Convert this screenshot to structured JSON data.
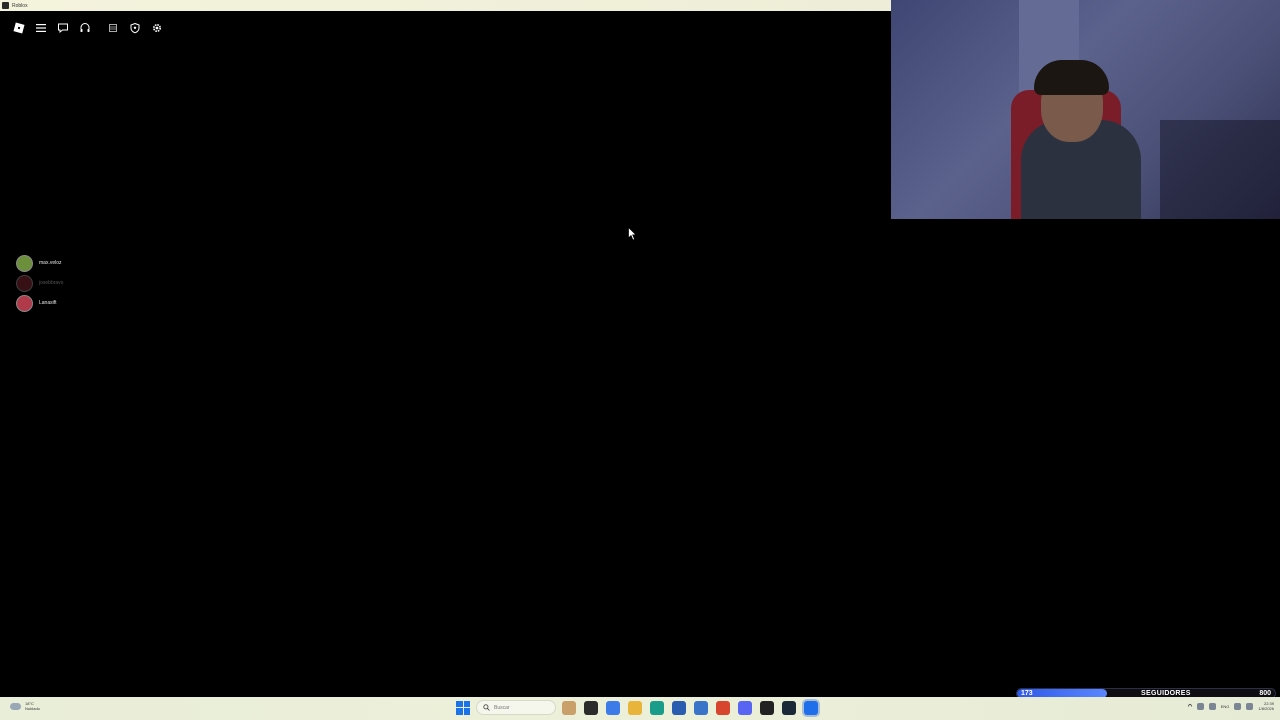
{
  "window": {
    "title": "Roblox"
  },
  "topbar": {
    "icons": [
      "roblox-logo-icon",
      "menu-icon",
      "chat-icon",
      "headset-icon",
      "inventory-icon",
      "shield-icon",
      "gear-icon"
    ]
  },
  "players": [
    {
      "name": "max.veloz",
      "avatar_color": "#6b8f3a",
      "dim": false
    },
    {
      "name": "josebbravo",
      "avatar_color": "#7a2530",
      "dim": true
    },
    {
      "name": "Lanasift",
      "avatar_color": "#b03a4a",
      "dim": false
    }
  ],
  "taskbar": {
    "weather_temp": "18°C",
    "weather_desc": "Nublado",
    "search_placeholder": "Buscar",
    "apps": [
      {
        "name": "assistant-app",
        "color": "#c9a06a"
      },
      {
        "name": "file-explorer-app",
        "color": "#2b2b2b"
      },
      {
        "name": "copilot-app",
        "color": "#3c7be8"
      },
      {
        "name": "folder-app",
        "color": "#e8b43a"
      },
      {
        "name": "edge-app",
        "color": "#1a9c8a"
      },
      {
        "name": "store-app",
        "color": "#2a5db0"
      },
      {
        "name": "mail-app",
        "color": "#3a74c9"
      },
      {
        "name": "chrome-app",
        "color": "#d8452e"
      },
      {
        "name": "discord-app",
        "color": "#5865f2"
      },
      {
        "name": "roblox-studio-app",
        "color": "#222222"
      },
      {
        "name": "steam-app",
        "color": "#1b2838"
      },
      {
        "name": "roblox-app",
        "color": "#1f6feb",
        "active": true
      }
    ],
    "tray_lang": "ENG",
    "clock_time": "22:39",
    "clock_date": "1/8/2026"
  },
  "followers": {
    "current": "173",
    "label": "SEGUIDORES",
    "goal": "800",
    "progress": 0.35
  }
}
